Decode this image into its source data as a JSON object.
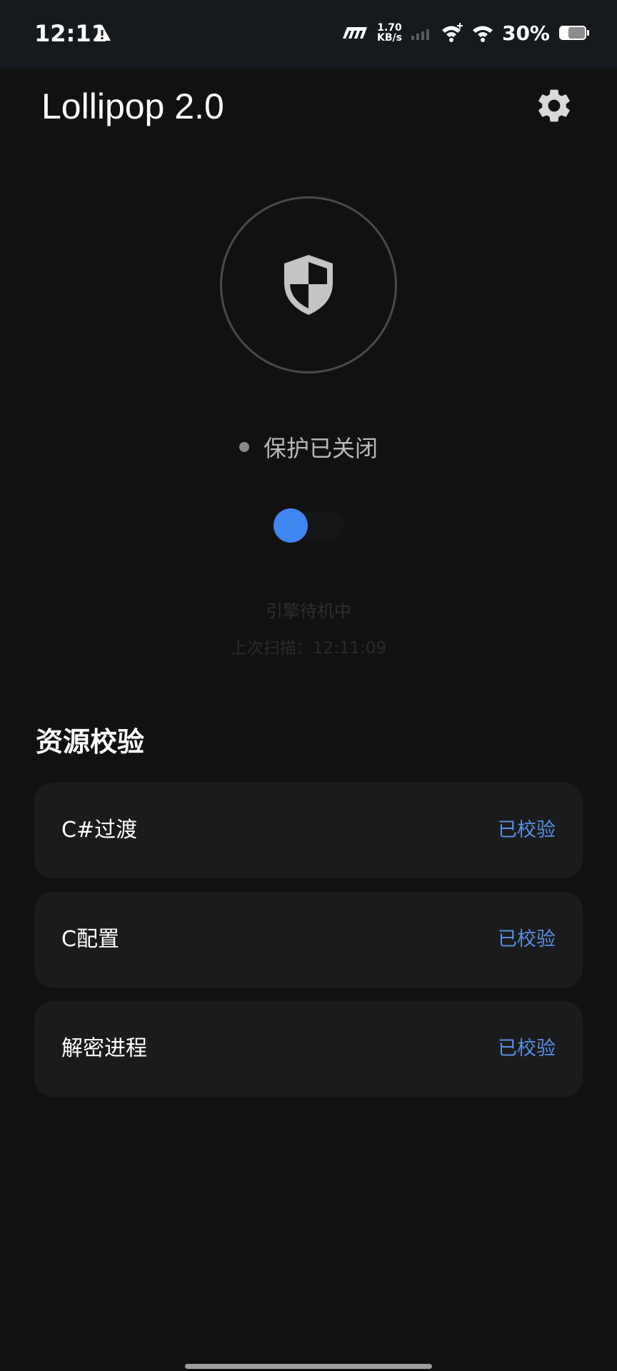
{
  "status_bar": {
    "time": "12:11",
    "network_speed_value": "1.70",
    "network_speed_unit": "KB/s",
    "battery_percent": "30%",
    "icons": [
      "alert-icon",
      "carrier-logo-icon",
      "signal-icon",
      "wifi-plus-icon",
      "wifi-icon",
      "battery-icon"
    ]
  },
  "header": {
    "title": "Lollipop 2.0",
    "settings_icon": "gear-icon"
  },
  "protection": {
    "shield_icon": "shield-icon",
    "status_text": "保护已关闭",
    "toggle_on": false,
    "toggle_color": "#3f86f0"
  },
  "engine": {
    "status_text": "引擎待机中",
    "last_scan_text": "上次扫描：12:11:09"
  },
  "resources": {
    "section_title": "资源校验",
    "items": [
      {
        "name": "C#过渡",
        "status": "已校验"
      },
      {
        "name": "C配置",
        "status": "已校验"
      },
      {
        "name": "解密进程",
        "status": "已校验"
      }
    ],
    "status_color": "#5b8de6"
  }
}
